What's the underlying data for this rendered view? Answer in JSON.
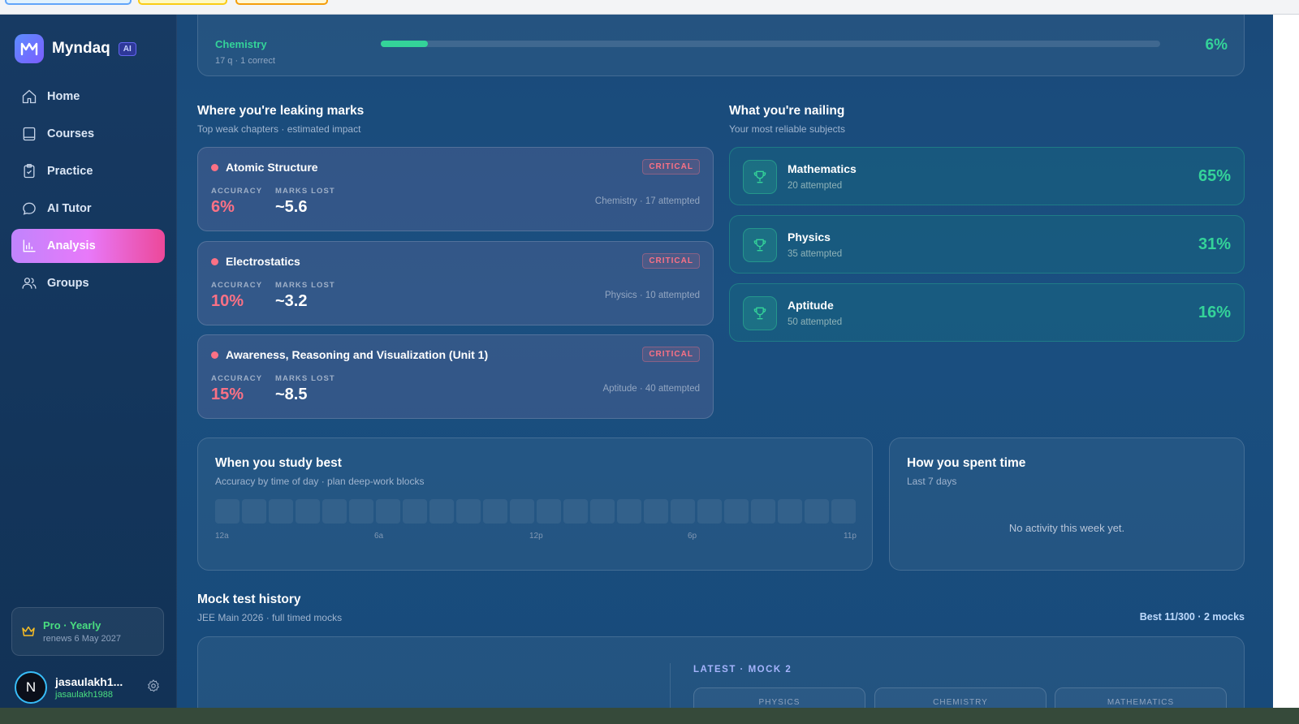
{
  "brand": {
    "name": "Myndaq",
    "badge": "AI"
  },
  "nav": [
    {
      "label": "Home",
      "icon": "home-icon"
    },
    {
      "label": "Courses",
      "icon": "book-icon"
    },
    {
      "label": "Practice",
      "icon": "clipboard-icon"
    },
    {
      "label": "AI Tutor",
      "icon": "chat-icon"
    },
    {
      "label": "Analysis",
      "icon": "bar-chart-icon",
      "active": true
    },
    {
      "label": "Groups",
      "icon": "users-icon"
    }
  ],
  "plan": {
    "title": "Pro · Yearly",
    "renews": "renews 6 May 2027"
  },
  "user": {
    "initial": "N",
    "name": "jasaulakh1...",
    "handle": "jasaulakh1988"
  },
  "subject_progress": {
    "name": "Chemistry",
    "sub": "17 q · 1 correct",
    "percent": "6%",
    "fraction": 0.06
  },
  "weak": {
    "title": "Where you're leaking marks",
    "subtitle": "Top weak chapters · estimated impact",
    "accuracy_label": "ACCURACY",
    "marks_label": "MARKS LOST",
    "badge": "CRITICAL",
    "items": [
      {
        "name": "Atomic Structure",
        "accuracy": "6%",
        "marks": "~5.6",
        "meta": "Chemistry · 17 attempted"
      },
      {
        "name": "Electrostatics",
        "accuracy": "10%",
        "marks": "~3.2",
        "meta": "Physics · 10 attempted"
      },
      {
        "name": "Awareness, Reasoning and Visualization (Unit 1)",
        "accuracy": "15%",
        "marks": "~8.5",
        "meta": "Aptitude · 40 attempted"
      }
    ]
  },
  "strong": {
    "title": "What you're nailing",
    "subtitle": "Your most reliable subjects",
    "items": [
      {
        "name": "Mathematics",
        "sub": "20 attempted",
        "percent": "65%"
      },
      {
        "name": "Physics",
        "sub": "35 attempted",
        "percent": "31%"
      },
      {
        "name": "Aptitude",
        "sub": "50 attempted",
        "percent": "16%"
      }
    ]
  },
  "study": {
    "title": "When you study best",
    "subtitle": "Accuracy by time of day · plan deep-work blocks",
    "hours": [
      "12a",
      "6a",
      "12p",
      "6p",
      "11p"
    ]
  },
  "time_spent": {
    "title": "How you spent time",
    "subtitle": "Last 7 days",
    "empty": "No activity this week yet."
  },
  "mock": {
    "title": "Mock test history",
    "subtitle": "JEE Main 2026 · full timed mocks",
    "best": "Best 11/300 · 2 mocks",
    "latest": "LATEST · MOCK 2",
    "subjects": [
      "PHYSICS",
      "CHEMISTRY",
      "MATHEMATICS"
    ]
  },
  "colors": {
    "accent_green": "#34d399",
    "critical": "#fb7185",
    "active_nav": "#d946ef"
  }
}
